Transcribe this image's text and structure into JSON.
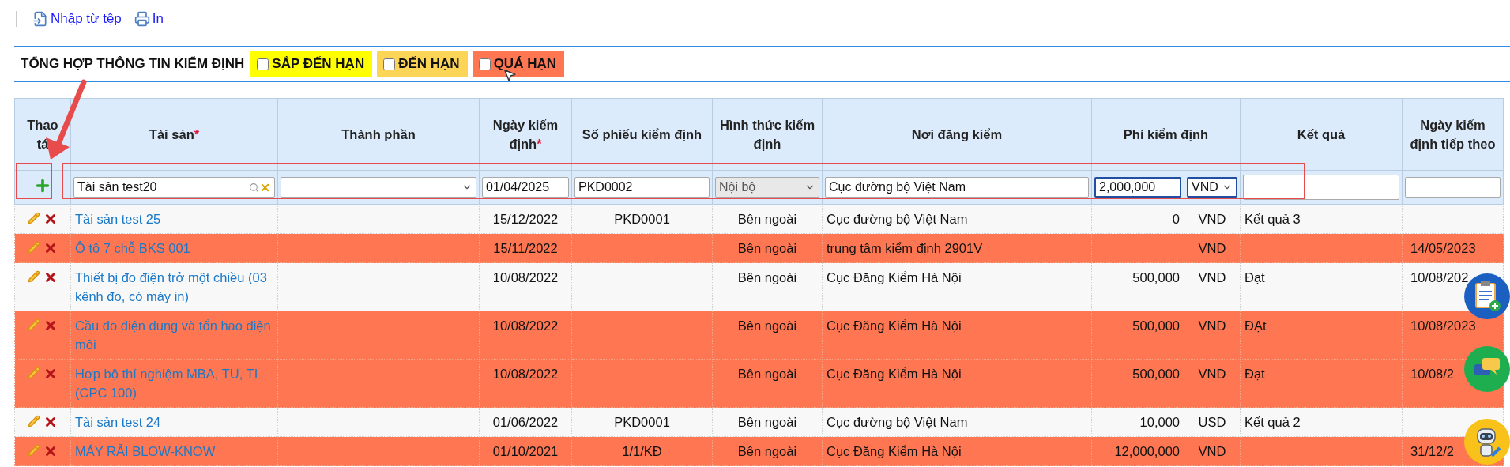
{
  "toolbar": [
    {
      "kind": "import",
      "label": "Nhập từ tệp"
    },
    {
      "kind": "print",
      "label": "In"
    }
  ],
  "summary": {
    "title": "TỔNG HỢP THÔNG TIN KIỂM ĐỊNH",
    "filters": [
      {
        "label": "SẮP ĐẾN HẠN",
        "checked": false,
        "color": "#ffff00"
      },
      {
        "label": "ĐẾN HẠN",
        "checked": false,
        "color": "#fdd556"
      },
      {
        "label": "QUÁ HẠN",
        "checked": false,
        "color": "#ff7752"
      }
    ]
  },
  "table": {
    "columns": [
      {
        "label": "Thao tá",
        "kind": "actions"
      },
      {
        "label": "Tài sản",
        "mark": "*",
        "kind": "plain"
      },
      {
        "label": "Thành phần",
        "kind": "plain"
      },
      {
        "label": "Ngày kiểm định",
        "mark": "*",
        "kind": "plain"
      },
      {
        "label": "Số phiếu kiểm định",
        "kind": "plain"
      },
      {
        "label": "Hình thức kiểm định",
        "kind": "plain"
      },
      {
        "label": "Nơi đăng kiểm",
        "kind": "plain"
      },
      {
        "label": "Phí kiểm định",
        "kind": "money"
      },
      {
        "label": "Kết quả",
        "kind": "plain"
      },
      {
        "label": "Ngày kiểm định tiếp theo",
        "kind": "plain"
      }
    ],
    "entry_row": {
      "fields": [
        {
          "kind": "lookup",
          "value": "Tài sản test20",
          "disabled": false,
          "focused": false
        },
        {
          "kind": "select",
          "disabled": false,
          "focused": false
        },
        {
          "kind": "text",
          "value": "01/04/2025",
          "disabled": false,
          "focused": false
        },
        {
          "kind": "text",
          "value": "PKD0002",
          "disabled": false,
          "focused": false
        },
        {
          "kind": "select",
          "value": "Nội bộ",
          "disabled": true,
          "focused": false
        },
        {
          "kind": "text",
          "value": "Cục đường bộ Việt Nam",
          "disabled": false,
          "focused": false
        },
        {
          "kind": "text",
          "value": "2,000,000",
          "disabled": false,
          "focused": true
        },
        {
          "kind": "select",
          "value": "VND",
          "disabled": false,
          "focused": true
        },
        {
          "kind": "textarea",
          "disabled": false,
          "focused": false
        },
        {
          "kind": "text",
          "disabled": false,
          "focused": false
        }
      ]
    },
    "rows": [
      {
        "overdue": false,
        "asset": "Tài sản test 25",
        "date": "15/12/2022",
        "number": "PKD0001",
        "method": "Bên ngoài",
        "place": "Cục đường bộ Việt Nam",
        "fee": "0",
        "currency": "VND",
        "result": "Kết quả 3"
      },
      {
        "overdue": true,
        "asset": "Ô tô 7 chỗ BKS 001",
        "date": "15/11/2022",
        "method": "Bên ngoài",
        "place": "trung tâm kiểm định 2901V",
        "currency": "VND",
        "next_date": "14/05/2023"
      },
      {
        "overdue": false,
        "asset": "Thiết bị đo điện trở một chiều (03 kênh đo, có máy in)",
        "date": "10/08/2022",
        "method": "Bên ngoài",
        "place": "Cục Đăng Kiểm Hà Nội",
        "fee": "500,000",
        "currency": "VND",
        "result": "Đạt",
        "next_date": "10/08/202"
      },
      {
        "overdue": true,
        "asset": "Cầu đo điện dung và tổn hao điện môi",
        "date": "10/08/2022",
        "method": "Bên ngoài",
        "place": "Cục Đăng Kiểm Hà Nội",
        "fee": "500,000",
        "currency": "VND",
        "result": "ĐẠt",
        "next_date": "10/08/2023"
      },
      {
        "overdue": true,
        "asset": "Hợp bộ thí nghiệm MBA, TU, TI (CPC 100)",
        "date": "10/08/2022",
        "method": "Bên ngoài",
        "place": "Cục Đăng Kiểm Hà Nội",
        "fee": "500,000",
        "currency": "VND",
        "result": "Đạt",
        "next_date": "10/08/2"
      },
      {
        "overdue": false,
        "asset": "Tài sản test 24",
        "date": "01/06/2022",
        "number": "PKD0001",
        "method": "Bên ngoài",
        "place": "Cục đường bộ Việt Nam",
        "fee": "10,000",
        "currency": "USD",
        "result": "Kết quả 2"
      },
      {
        "overdue": true,
        "asset": "MÁY RẢI BLOW-KNOW",
        "date": "01/10/2021",
        "number": "1/1/KĐ",
        "method": "Bên ngoài",
        "place": "Cục Đăng Kiểm Hà Nội",
        "fee": "12,000,000",
        "currency": "VND",
        "next_date": "31/12/2"
      }
    ]
  }
}
